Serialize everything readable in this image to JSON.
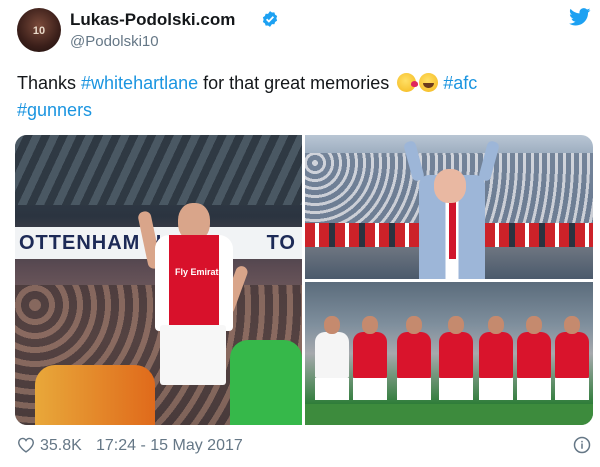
{
  "author": {
    "display_name": "Lukas-Podolski.com",
    "handle": "@Podolski10",
    "avatar_number": "10"
  },
  "tweet": {
    "text_plain": "Thanks ",
    "hashtag_1": "#whitehartlane",
    "text_mid": " for that great memories ",
    "hashtag_2": "#afc",
    "hashtag_3": "#gunners"
  },
  "media": {
    "photo1_banner": "OTTENHAM HO",
    "photo1_banner_right": "TO",
    "photo1_sponsor": "Fly Emirates"
  },
  "footer": {
    "likes": "35.8K",
    "timestamp": "17:24 - 15 May 2017"
  },
  "icons": {
    "verified": "verified-badge-icon",
    "twitter": "twitter-bird-icon",
    "like": "heart-icon",
    "info": "info-icon"
  },
  "colors": {
    "link": "#1b95e0",
    "secondary_text": "#657786",
    "verified_blue": "#1da1f2"
  }
}
